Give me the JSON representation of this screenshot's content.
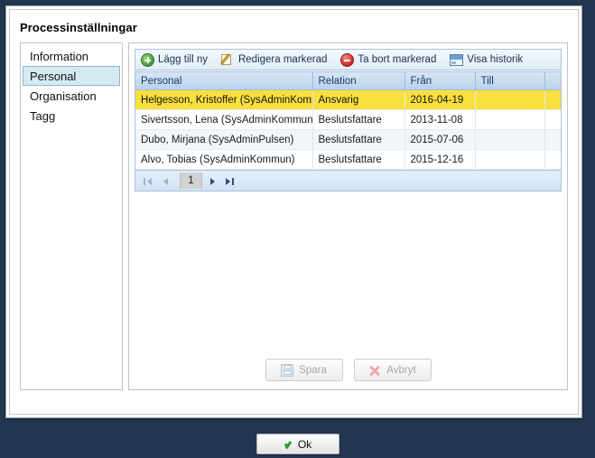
{
  "window": {
    "title": "Processinställningar",
    "background_color": "#22364f",
    "panel_color": "#ffffff"
  },
  "sidebar": {
    "items": [
      {
        "label": "Information",
        "selected": false
      },
      {
        "label": "Personal",
        "selected": true
      },
      {
        "label": "Organisation",
        "selected": false
      },
      {
        "label": "Tagg",
        "selected": false
      }
    ],
    "selected_color": "#d4eaf2"
  },
  "toolbar": {
    "buttons": [
      {
        "label": "Lägg till ny",
        "icon": "add-circle-icon"
      },
      {
        "label": "Redigera markerad",
        "icon": "edit-pencil-icon"
      },
      {
        "label": "Ta bort markerad",
        "icon": "delete-circle-icon"
      },
      {
        "label": "Visa historik",
        "icon": "history-window-icon"
      }
    ]
  },
  "grid": {
    "columns": [
      "Personal",
      "Relation",
      "Från",
      "Till",
      ""
    ],
    "rows": [
      {
        "personal": "Helgesson, Kristoffer (SysAdminKommun)",
        "relation": "Ansvarig",
        "fran": "2016-04-19",
        "till": "",
        "extra": "",
        "selected": true
      },
      {
        "personal": "Sivertsson, Lena (SysAdminKommun)",
        "relation": "Beslutsfattare",
        "fran": "2013-11-08",
        "till": "",
        "extra": "",
        "selected": false
      },
      {
        "personal": "Dubo, Mirjana (SysAdminPulsen)",
        "relation": "Beslutsfattare",
        "fran": "2015-07-06",
        "till": "",
        "extra": "",
        "selected": false
      },
      {
        "personal": "Alvo, Tobias (SysAdminKommun)",
        "relation": "Beslutsfattare",
        "fran": "2015-12-16",
        "till": "",
        "extra": "",
        "selected": false
      }
    ],
    "selected_row_color": "#f9e03e",
    "header_color": "#b9d2ea"
  },
  "pager": {
    "first_icon": "first-page-icon",
    "prev_icon": "previous-page-icon",
    "current_page": "1",
    "next_icon": "next-page-icon",
    "last_icon": "last-page-icon"
  },
  "form_actions": {
    "save_label": "Spara",
    "save_icon": "floppy-disk-icon",
    "cancel_label": "Avbryt",
    "cancel_icon": "cross-icon",
    "disabled": true
  },
  "dialog_actions": {
    "ok_label": "Ok",
    "ok_icon": "check-icon"
  }
}
